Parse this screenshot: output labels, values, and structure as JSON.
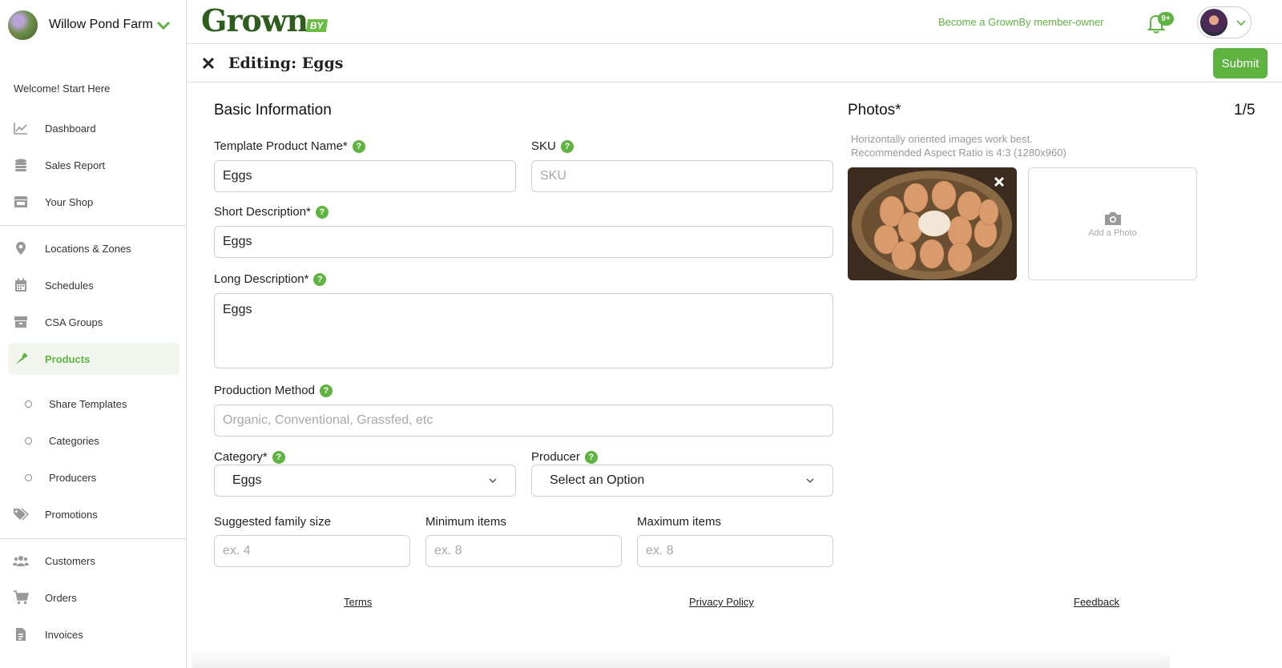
{
  "sidebar": {
    "farm_name": "Willow Pond Farm",
    "welcome": "Welcome! Start Here",
    "items": [
      {
        "label": "Dashboard",
        "icon": "chart-line-icon"
      },
      {
        "label": "Sales Report",
        "icon": "coins-icon"
      },
      {
        "label": "Your Shop",
        "icon": "store-icon"
      },
      {
        "label": "Locations & Zones",
        "icon": "map-pin-icon"
      },
      {
        "label": "Schedules",
        "icon": "calendar-icon"
      },
      {
        "label": "CSA Groups",
        "icon": "box-icon"
      },
      {
        "label": "Products",
        "icon": "carrot-icon",
        "active": true
      },
      {
        "label": "Promotions",
        "icon": "tags-icon"
      },
      {
        "label": "Customers",
        "icon": "users-icon"
      },
      {
        "label": "Orders",
        "icon": "cart-icon"
      },
      {
        "label": "Invoices",
        "icon": "invoice-icon"
      }
    ],
    "sub_items": [
      "Share Templates",
      "Categories",
      "Producers"
    ]
  },
  "header": {
    "logo_text": "Grown",
    "logo_badge": "BY",
    "member_link": "Become a GrownBy member-owner",
    "notification_badge": "9+"
  },
  "editbar": {
    "title": "Editing: Eggs",
    "submit_label": "Submit"
  },
  "form": {
    "section_title": "Basic Information",
    "template_name": {
      "label": "Template Product Name*",
      "value": "Eggs"
    },
    "sku": {
      "label": "SKU",
      "placeholder": "SKU"
    },
    "short_description": {
      "label": "Short Description*",
      "value": "Eggs"
    },
    "long_description": {
      "label": "Long Description*",
      "value": "Eggs"
    },
    "production_method": {
      "label": "Production Method",
      "placeholder": "Organic, Conventional, Grassfed, etc"
    },
    "category": {
      "label": "Category*",
      "value": "Eggs"
    },
    "producer": {
      "label": "Producer",
      "value": "Select an Option"
    },
    "family_size": {
      "label": "Suggested family size",
      "placeholder": "ex. 4"
    },
    "min_items": {
      "label": "Minimum items",
      "placeholder": "ex. 8"
    },
    "max_items": {
      "label": "Maximum items",
      "placeholder": "ex. 8"
    },
    "help_glyph": "?"
  },
  "photos": {
    "title": "Photos*",
    "count": "1/5",
    "hint_line1": "Horizontally oriented images work best.",
    "hint_line2": "Recommended Aspect Ratio is 4:3 (1280x960)",
    "add_label": "Add a Photo"
  },
  "footer": {
    "terms": "Terms",
    "privacy": "Privacy Policy",
    "feedback": "Feedback"
  },
  "colors": {
    "accent": "#5fb340",
    "logo_dark": "#2f5d1e"
  }
}
